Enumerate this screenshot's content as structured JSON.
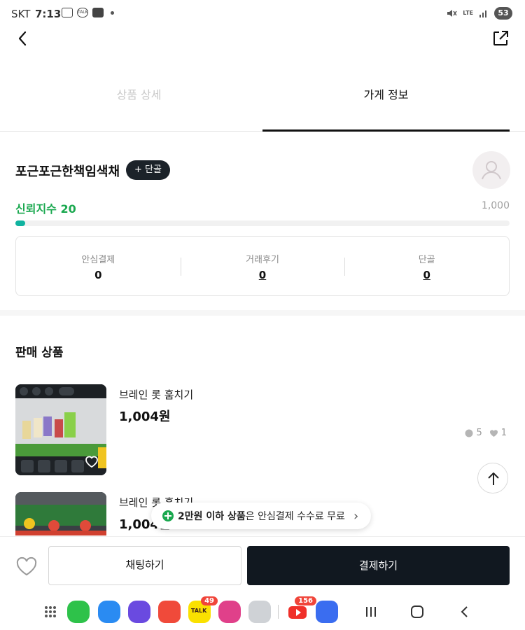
{
  "status_bar": {
    "carrier": "SKT",
    "time": "7:13",
    "notif_talk": "TALK",
    "network": "LTE",
    "battery": "53"
  },
  "tabs": [
    {
      "label": "상품 상세",
      "active": false
    },
    {
      "label": "가게 정보",
      "active": true
    }
  ],
  "store": {
    "name": "포근포근한책임색채",
    "regular_button": "+ 단골",
    "trust_label": "신뢰지수 20",
    "trust_value": 20,
    "trust_max": "1,000",
    "trust_max_value": 1000
  },
  "stats": [
    {
      "label": "안심결제",
      "value": "0",
      "link": false
    },
    {
      "label": "거래후기",
      "value": "0",
      "link": true
    },
    {
      "label": "단골",
      "value": "0",
      "link": true
    }
  ],
  "section": {
    "title": "판매 상품"
  },
  "products": [
    {
      "title": "브레인 롯 훔치기",
      "price": "1,004원",
      "chats": "5",
      "likes": "1"
    },
    {
      "title": "브레인 롯 훔치기",
      "price": "1,004원"
    }
  ],
  "toast": {
    "bold": "2만원 이하 상품",
    "rest": "은 안심결제 수수료 무료",
    "chevron": "›"
  },
  "bottom": {
    "chat_button": "채팅하기",
    "pay_button": "결제하기"
  },
  "dock": {
    "kakao_badge": "49",
    "kakao_label": "TALK",
    "youtube_badge": "156"
  },
  "colors": {
    "trust_green": "#1aa84f",
    "progress_teal": "#10b3a0",
    "pay_button": "#111820",
    "regular_button": "#1b2229"
  }
}
